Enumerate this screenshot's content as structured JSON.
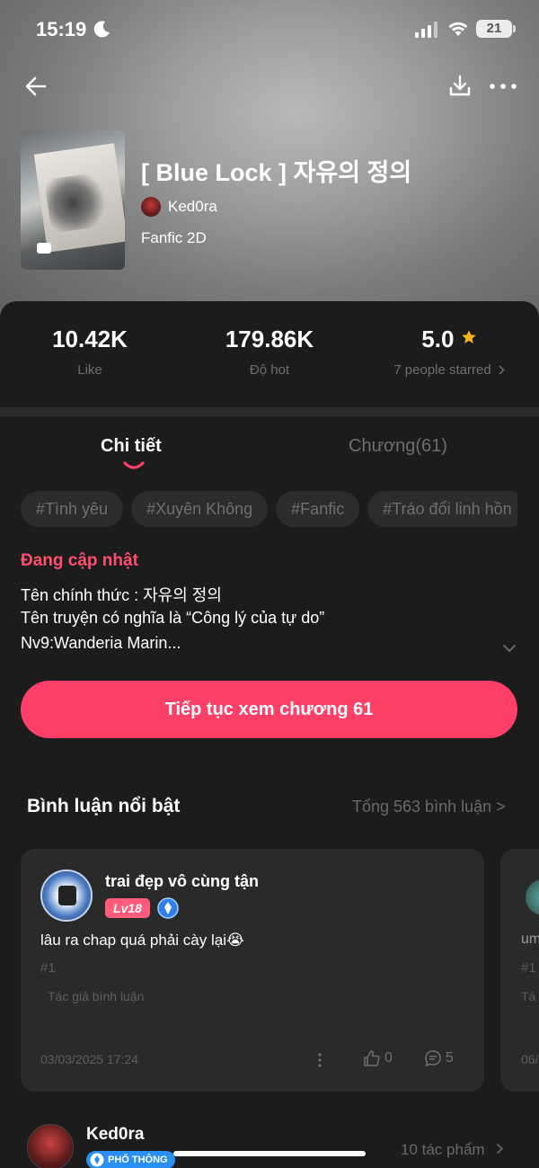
{
  "status_bar": {
    "time": "15:19",
    "battery": "21"
  },
  "book": {
    "title": "[ Blue Lock ] 자유의 정의",
    "author": "Ked0ra",
    "genre": "Fanfic 2D"
  },
  "stats": {
    "likes_value": "10.42K",
    "likes_label": "Like",
    "hot_value": "179.86K",
    "hot_label": "Độ hot",
    "rating_value": "5.0",
    "rating_label": "7 people starred"
  },
  "tabs": {
    "details": "Chi tiết",
    "chapters": "Chương(61)"
  },
  "tags": [
    "#Tình yêu",
    "#Xuyên Không",
    "#Fanfic",
    "#Tráo đổi linh hồn"
  ],
  "description": {
    "status": "Đang cập nhật",
    "line1": "Tên chính thức : 자유의 정의",
    "line2": "Tên truyện có nghĩa là “Công lý của tự do”",
    "line3": "Nv9:Wanderia Marin..."
  },
  "continue_button": "Tiếp tục xem chương 61",
  "comments": {
    "title": "Bình luận nổi bật",
    "total": "Tổng 563 bình luận >",
    "items": [
      {
        "user": "trai đẹp vô cùng tận",
        "level": "Lv18",
        "text": "lâu ra chap quá phải cày lại😭",
        "index": "#1",
        "note": "Tác giả bình luận",
        "date": "03/03/2025 17:24",
        "likes": "0",
        "replies": "5"
      }
    ],
    "peek": {
      "text": "um",
      "index": "#1",
      "note": "Tá",
      "date": "06/"
    }
  },
  "author_card": {
    "name": "Ked0ra",
    "badge": "PHỔ THÔNG",
    "works": "10 tác phẩm"
  },
  "colors": {
    "accent": "#fe3f68",
    "status": "#ff4f6e",
    "star": "#f5b21b"
  }
}
